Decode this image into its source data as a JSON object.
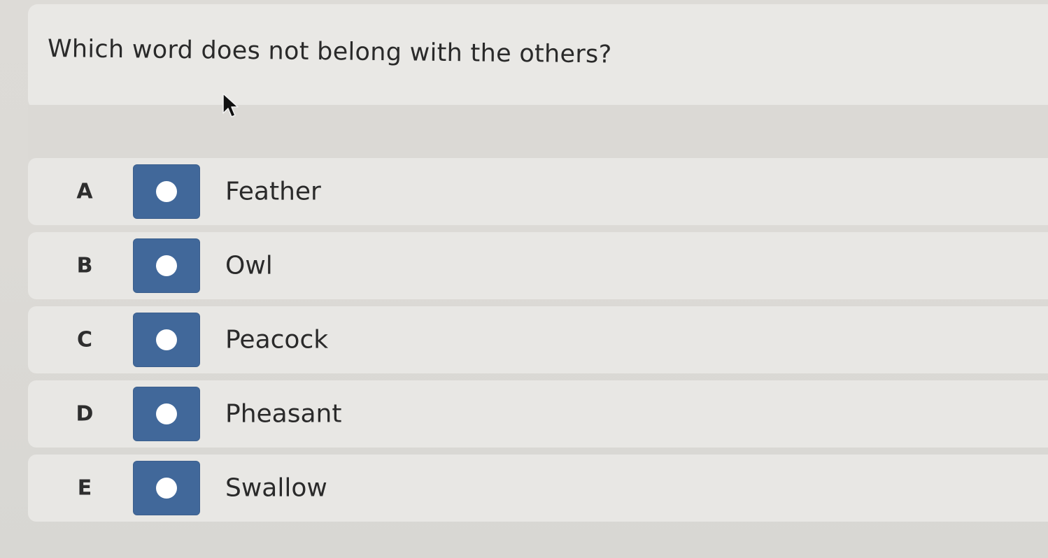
{
  "question": {
    "text": "Which word does not belong with the others?"
  },
  "options": [
    {
      "letter": "A",
      "label": "Feather"
    },
    {
      "letter": "B",
      "label": "Owl"
    },
    {
      "letter": "C",
      "label": "Peacock"
    },
    {
      "letter": "D",
      "label": "Pheasant"
    },
    {
      "letter": "E",
      "label": "Swallow"
    }
  ],
  "colors": {
    "radio_fill": "#41689a",
    "radio_dot": "#ffffff",
    "card_background": "#e8e7e4",
    "text": "#2a2a2a"
  },
  "icons": {
    "cursor": "mouse-pointer-icon",
    "radio": "radio-button-unselected-icon"
  }
}
